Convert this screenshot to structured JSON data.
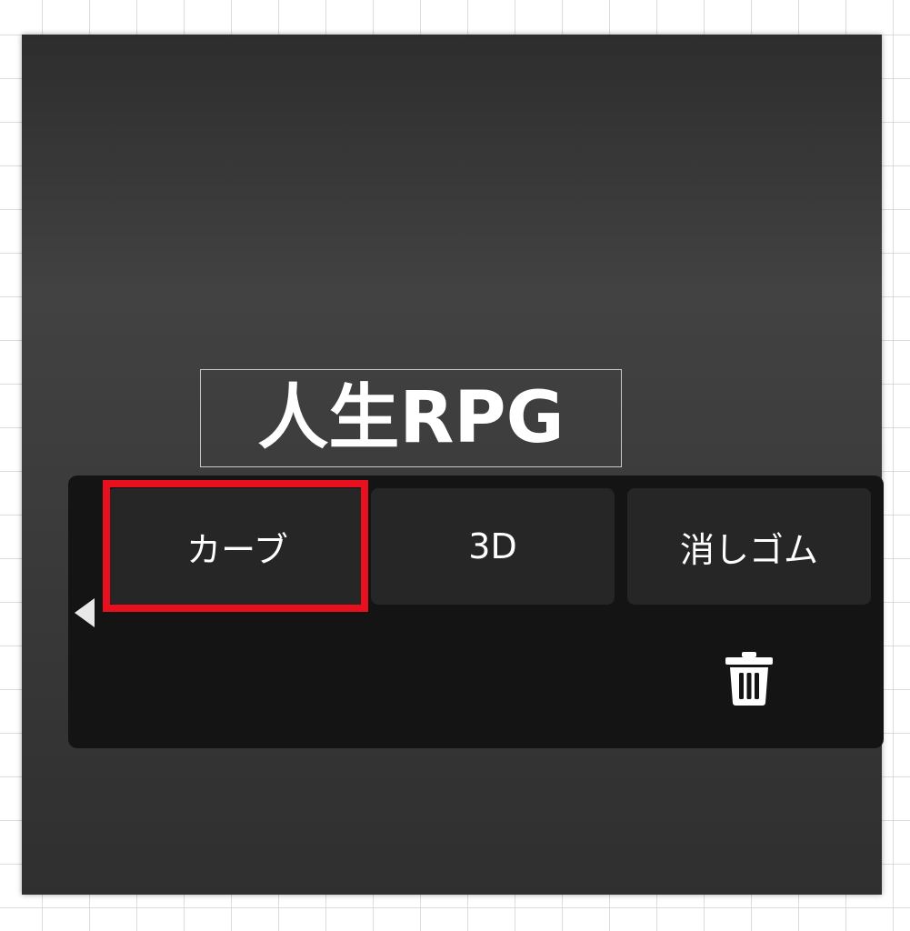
{
  "canvas": {
    "text_layer": "人生RPG"
  },
  "tool_menu": {
    "buttons": [
      {
        "label": "カーブ",
        "highlighted": true
      },
      {
        "label": "3D",
        "highlighted": false
      },
      {
        "label": "消しゴム",
        "highlighted": false
      }
    ],
    "back_icon": "triangle-left-icon",
    "delete_icon": "trash-icon"
  },
  "colors": {
    "highlight": "#e8101e",
    "panel": "#141414",
    "button": "#262626",
    "canvas": "#3a3a3a"
  }
}
